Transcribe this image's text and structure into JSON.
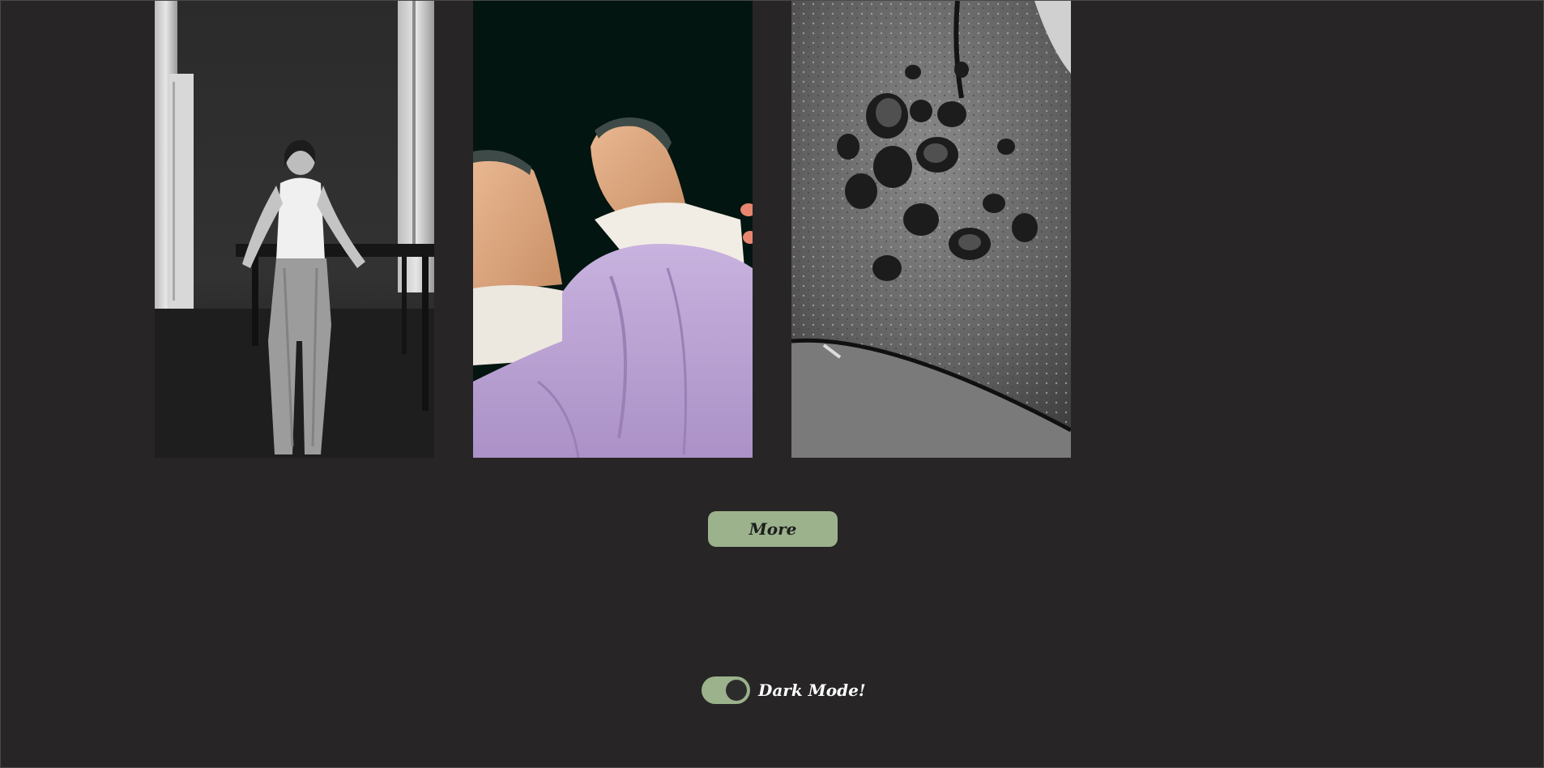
{
  "gallery": {
    "photos": [
      {
        "name": "woman-leaning-on-table-photo",
        "style": "black-and-white"
      },
      {
        "name": "knees-lavender-skirt-photo",
        "style": "color"
      },
      {
        "name": "rock-texture-photo",
        "style": "black-and-white"
      }
    ]
  },
  "more_button": {
    "label": "More"
  },
  "dark_mode": {
    "label": "Dark Mode!",
    "enabled": true
  },
  "colors": {
    "background": "#272526",
    "accent": "#9bb28c",
    "knob": "#2d2c2d",
    "button_text": "#1d1d1d",
    "label_text": "#ffffff"
  }
}
